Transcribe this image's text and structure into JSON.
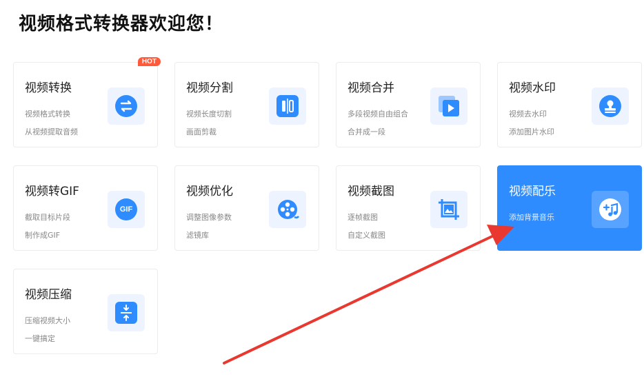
{
  "page": {
    "title": "视频格式转换器欢迎您！"
  },
  "colors": {
    "accent": "#2f8cff",
    "hot": "#ff5a3c",
    "arrow": "#e8382f"
  },
  "cards": [
    {
      "title": "视频转换",
      "line1": "视频格式转换",
      "line2": "从视频提取音频",
      "icon": "convert-icon",
      "badge": "HOT"
    },
    {
      "title": "视频分割",
      "line1": "视频长度切割",
      "line2": "画面剪裁",
      "icon": "split-icon"
    },
    {
      "title": "视频合并",
      "line1": "多段视频自由组合",
      "line2": "合并成一段",
      "icon": "merge-icon"
    },
    {
      "title": "视频水印",
      "line1": "视频去水印",
      "line2": "添加图片水印",
      "icon": "watermark-icon"
    },
    {
      "title": "视频转GIF",
      "line1": "截取目标片段",
      "line2": "制作成GIF",
      "icon": "gif-icon",
      "icon_text": "GIF"
    },
    {
      "title": "视频优化",
      "line1": "调整图像参数",
      "line2": "滤镜库",
      "icon": "optimize-icon"
    },
    {
      "title": "视频截图",
      "line1": "逐帧截图",
      "line2": "自定义截图",
      "icon": "screenshot-icon"
    },
    {
      "title": "视频配乐",
      "line1": "添加背景音乐",
      "line2": "",
      "icon": "music-icon",
      "active": true
    },
    {
      "title": "视频压缩",
      "line1": "压缩视频大小",
      "line2": "一键搞定",
      "icon": "compress-icon"
    }
  ]
}
